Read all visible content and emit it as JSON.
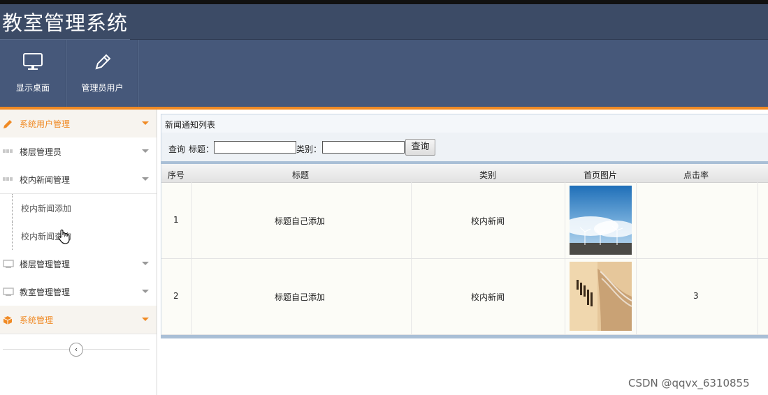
{
  "app": {
    "title": "教室管理系统"
  },
  "toolbar": {
    "items": [
      {
        "label": "显示桌面",
        "icon": "monitor-icon"
      },
      {
        "label": "管理员用户",
        "icon": "pencil-icon"
      }
    ]
  },
  "sidebar": {
    "items": [
      {
        "label": "系统用户管理",
        "icon": "pencil-icon",
        "active": true
      },
      {
        "label": "楼层管理员",
        "icon": "grid-icon"
      },
      {
        "label": "校内新闻管理",
        "icon": "grid-icon"
      },
      {
        "label": "楼层管理管理",
        "icon": "screen-icon"
      },
      {
        "label": "教室管理管理",
        "icon": "screen-icon"
      },
      {
        "label": "系统管理",
        "icon": "box-icon",
        "active": true
      }
    ],
    "subitems": [
      {
        "label": "校内新闻添加"
      },
      {
        "label": "校内新闻查询"
      }
    ],
    "collapse_glyph": "‹"
  },
  "main": {
    "panel_title": "新闻通知列表",
    "search": {
      "label_query": "查询",
      "label_title": "标题：",
      "label_category": "类别：",
      "title_value": "",
      "category_value": "",
      "button_label": "查询"
    },
    "table": {
      "headers": [
        "序号",
        "标题",
        "类别",
        "首页图片",
        "点击率"
      ],
      "rows": [
        {
          "index": "1",
          "title": "标题自己添加",
          "category": "校内新闻",
          "image": "wind-turbine-photo",
          "clicks": ""
        },
        {
          "index": "2",
          "title": "标题自己添加",
          "category": "校内新闻",
          "image": "book-photo",
          "clicks": "3"
        }
      ]
    }
  },
  "watermark": "CSDN @qqvx_6310855",
  "colors": {
    "header": "#3c4b66",
    "toolbar": "#46587a",
    "accent": "#f08a24",
    "grid_border": "#a9bfd6"
  }
}
